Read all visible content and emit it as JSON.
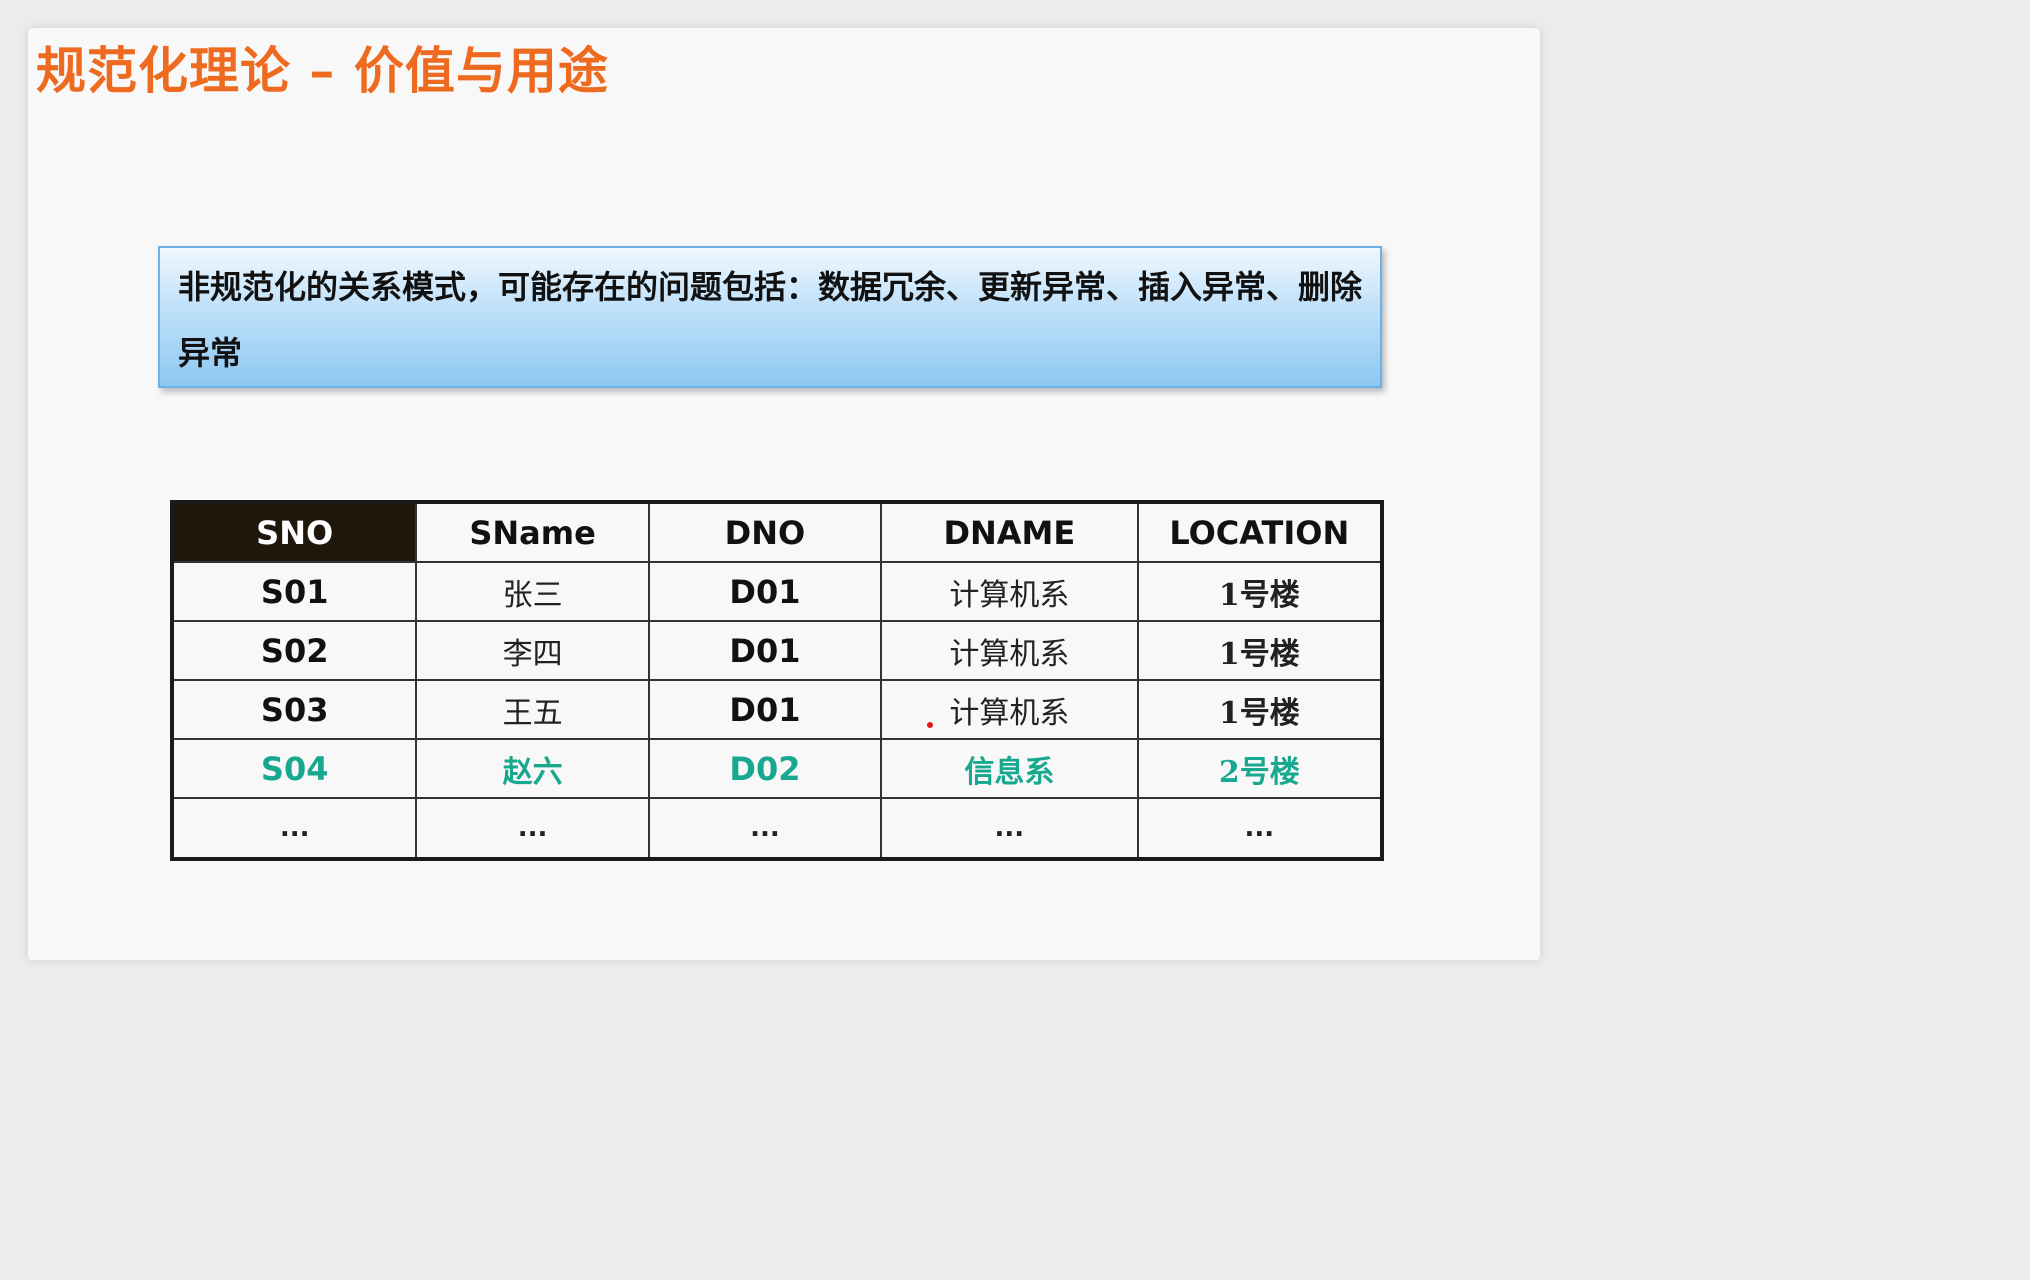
{
  "slide": {
    "title": "规范化理论 – 价值与用途",
    "callout": "非规范化的关系模式，可能存在的问题包括：数据冗余、更新异常、插入异常、删除异常"
  },
  "table": {
    "headers": [
      "SNO",
      "SName",
      "DNO",
      "DNAME",
      "LOCATION"
    ],
    "rows": [
      [
        "S01",
        "张三",
        "D01",
        "计算机系",
        "1号楼"
      ],
      [
        "S02",
        "李四",
        "D01",
        "计算机系",
        "1号楼"
      ],
      [
        "S03",
        "王五",
        "D01",
        "计算机系",
        "1号楼"
      ],
      [
        "S04",
        "赵六",
        "D02",
        "信息系",
        "2号楼"
      ],
      [
        "...",
        "...",
        "...",
        "...",
        "..."
      ]
    ],
    "highlight_row_index": 3,
    "highlight_color": "#18a890",
    "key_header_color": "#1f160c"
  },
  "colors": {
    "title": "#ee6a1e",
    "callout_border": "#6cb0e6",
    "callout_fill": "#c5e3fa",
    "annotation_dot": "#e01818"
  }
}
